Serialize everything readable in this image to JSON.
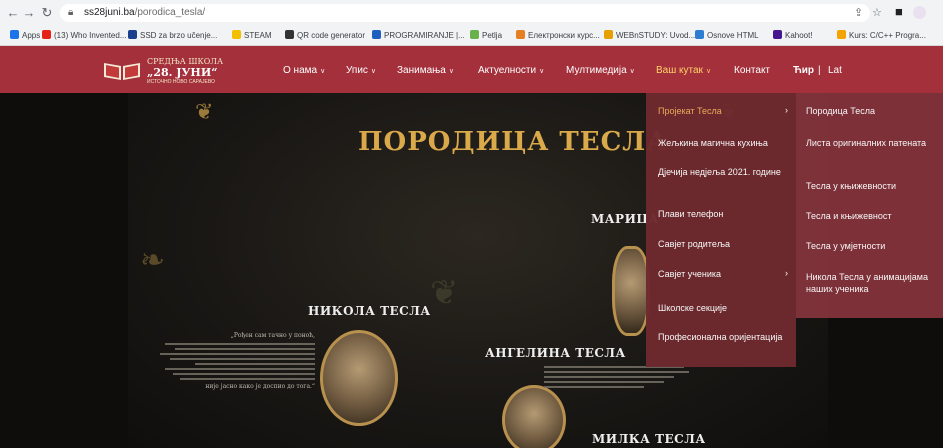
{
  "browser": {
    "url_host": "ss28juni.ba",
    "url_path": "/porodica_tesla/",
    "bookmarks": [
      {
        "label": "Apps",
        "color": "#1a73e8"
      },
      {
        "label": "(13) Who Invented...",
        "color": "#e62117"
      },
      {
        "label": "SSD za brzo učenje...",
        "color": "#1a3f8f"
      },
      {
        "label": "STEAM",
        "color": "#f2c000"
      },
      {
        "label": "QR code generator",
        "color": "#333333"
      },
      {
        "label": "PROGRAMIRANJE |...",
        "color": "#1f5fbf"
      },
      {
        "label": "Petlja",
        "color": "#6ab04c"
      },
      {
        "label": "Електронски курс...",
        "color": "#e67e22"
      },
      {
        "label": "WEBnSTUDY: Uvod...",
        "color": "#e6a100"
      },
      {
        "label": "Osnove HTML",
        "color": "#2d7dd2"
      },
      {
        "label": "Kahoot!",
        "color": "#46178f"
      },
      {
        "label": "Kurs: C/C++ Progra...",
        "color": "#f4a300"
      }
    ]
  },
  "site": {
    "logo_line1": "СРЕДЊА ШКОЛА",
    "logo_line2": "„28. ЈУНИ“",
    "logo_line3": "ИСТОЧНО НОВО САРАЈЕВО",
    "nav": [
      {
        "label": "О нама",
        "chevron": true
      },
      {
        "label": "Упис",
        "chevron": true
      },
      {
        "label": "Занимања",
        "chevron": true
      },
      {
        "label": "Актуелности",
        "chevron": true
      },
      {
        "label": "Мултимедија",
        "chevron": true
      },
      {
        "label": "Ваш кутак",
        "chevron": true
      },
      {
        "label": "Контакт",
        "chevron": false
      }
    ],
    "lang_cyr": "Ћир",
    "lang_sep": "|",
    "lang_lat": "Lat",
    "accent_color": "#a3303b"
  },
  "poster": {
    "title": "ПОРОДИЦА ТЕСЛА",
    "names": {
      "nikola": "НИКОЛА ТЕСЛА",
      "marica": "МАРИЦА",
      "angelina": "АНГЕЛИНА ТЕСЛА",
      "milka": "МИЛКА ТЕСЛА"
    },
    "quote_start": "„Рођен сам тачно у поноћ,",
    "quote_end": "није јасно како је доспио до тога.“"
  },
  "dropdown_primary": [
    {
      "label": "Пројекат Тесла",
      "arrow": true,
      "active": true
    },
    {
      "label": "Жељкина магична кухиња",
      "arrow": false
    },
    {
      "label": "Дјечија недјеља 2021. године",
      "arrow": false
    },
    {
      "label": "Плави телефон",
      "arrow": false
    },
    {
      "label": "Савјет родитеља",
      "arrow": false
    },
    {
      "label": "Савјет ученика",
      "arrow": true
    },
    {
      "label": "Школске секције",
      "arrow": false
    },
    {
      "label": "Професионална оријентација",
      "arrow": false
    }
  ],
  "dropdown_secondary": [
    {
      "label": "Породица Тесла"
    },
    {
      "label": "Листа оригиналних патената"
    },
    {
      "label": "Тесла у књижевности"
    },
    {
      "label": "Тесла и књижевност"
    },
    {
      "label": "Тесла у умјетности"
    },
    {
      "label": "Никола Тесла у анимацијама наших ученика"
    }
  ]
}
